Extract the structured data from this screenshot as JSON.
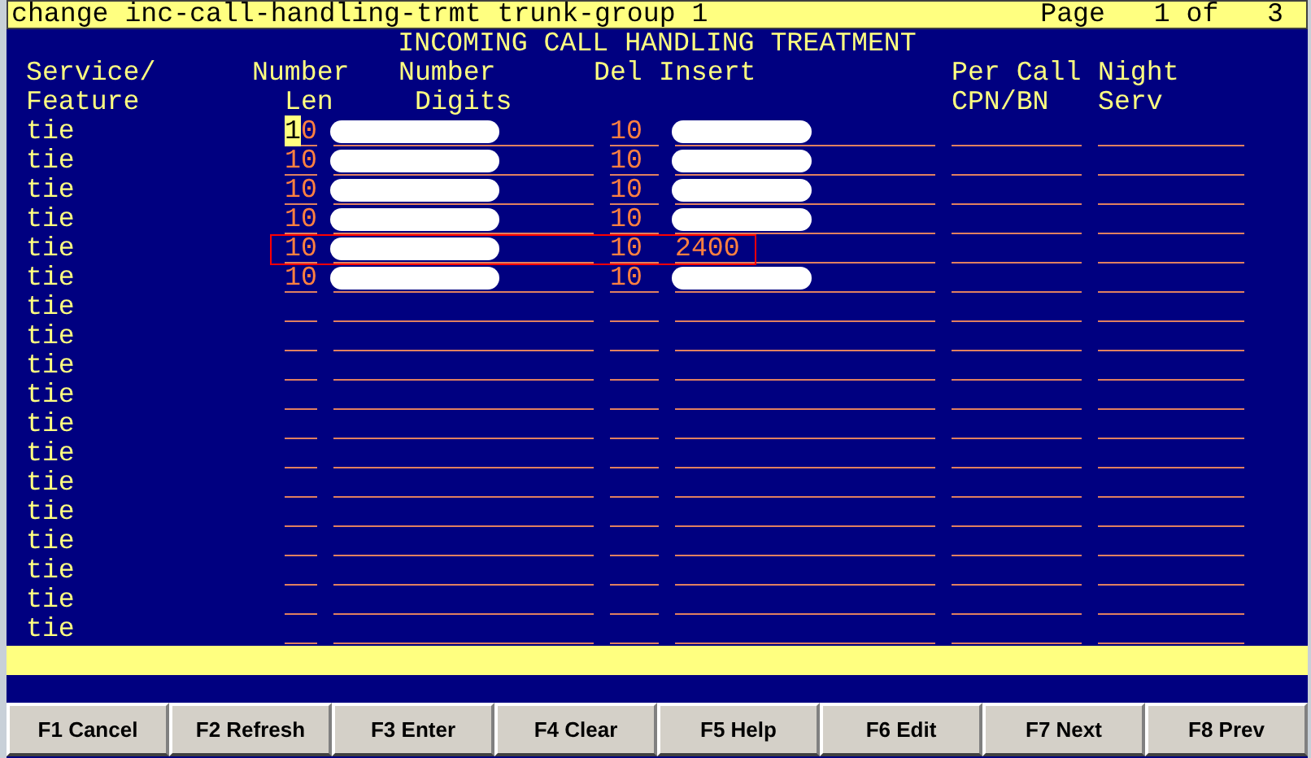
{
  "command_bar": {
    "command": "change inc-call-handling-trmt trunk-group 1",
    "page": "Page   1 of   3"
  },
  "form_title": "INCOMING CALL HANDLING TREATMENT",
  "headers": {
    "service": [
      "Service/",
      "Feature"
    ],
    "number_len": [
      "Number",
      "Len"
    ],
    "number_digits": [
      "Number",
      "Digits"
    ],
    "del": "Del",
    "insert": "Insert",
    "per_call": [
      "Per Call",
      "CPN/BN"
    ],
    "night": [
      "Night",
      "Serv"
    ]
  },
  "rows": [
    {
      "service": "tie",
      "len": "10",
      "cursor": true,
      "digits_redacted": true,
      "del": "10",
      "insert_redacted": true,
      "highlighted": false
    },
    {
      "service": "tie",
      "len": "10",
      "cursor": false,
      "digits_redacted": true,
      "del": "10",
      "insert_redacted": true,
      "highlighted": false
    },
    {
      "service": "tie",
      "len": "10",
      "cursor": false,
      "digits_redacted": true,
      "del": "10",
      "insert_redacted": true,
      "highlighted": false
    },
    {
      "service": "tie",
      "len": "10",
      "cursor": false,
      "digits_redacted": true,
      "del": "10",
      "insert_redacted": true,
      "highlighted": false
    },
    {
      "service": "tie",
      "len": "10",
      "cursor": false,
      "digits_redacted": true,
      "del": "10",
      "insert": "2400",
      "insert_redacted": false,
      "highlighted": true
    },
    {
      "service": "tie",
      "len": "10",
      "cursor": false,
      "digits_redacted": true,
      "del": "10",
      "insert_redacted": true,
      "highlighted": false
    },
    {
      "service": "tie",
      "cursor": false,
      "digits_redacted": false,
      "insert_redacted": false,
      "highlighted": false
    },
    {
      "service": "tie",
      "cursor": false,
      "digits_redacted": false,
      "insert_redacted": false,
      "highlighted": false
    },
    {
      "service": "tie",
      "cursor": false,
      "digits_redacted": false,
      "insert_redacted": false,
      "highlighted": false
    },
    {
      "service": "tie",
      "cursor": false,
      "digits_redacted": false,
      "insert_redacted": false,
      "highlighted": false
    },
    {
      "service": "tie",
      "cursor": false,
      "digits_redacted": false,
      "insert_redacted": false,
      "highlighted": false
    },
    {
      "service": "tie",
      "cursor": false,
      "digits_redacted": false,
      "insert_redacted": false,
      "highlighted": false
    },
    {
      "service": "tie",
      "cursor": false,
      "digits_redacted": false,
      "insert_redacted": false,
      "highlighted": false
    },
    {
      "service": "tie",
      "cursor": false,
      "digits_redacted": false,
      "insert_redacted": false,
      "highlighted": false
    },
    {
      "service": "tie",
      "cursor": false,
      "digits_redacted": false,
      "insert_redacted": false,
      "highlighted": false
    },
    {
      "service": "tie",
      "cursor": false,
      "digits_redacted": false,
      "insert_redacted": false,
      "highlighted": false
    },
    {
      "service": "tie",
      "cursor": false,
      "digits_redacted": false,
      "insert_redacted": false,
      "highlighted": false
    },
    {
      "service": "tie",
      "cursor": false,
      "digits_redacted": false,
      "insert_redacted": false,
      "highlighted": false
    }
  ],
  "function_keys": [
    "F1 Cancel",
    "F2 Refresh",
    "F3 Enter",
    "F4 Clear",
    "F5 Help",
    "F6 Edit",
    "F7 Next",
    "F8 Prev"
  ]
}
